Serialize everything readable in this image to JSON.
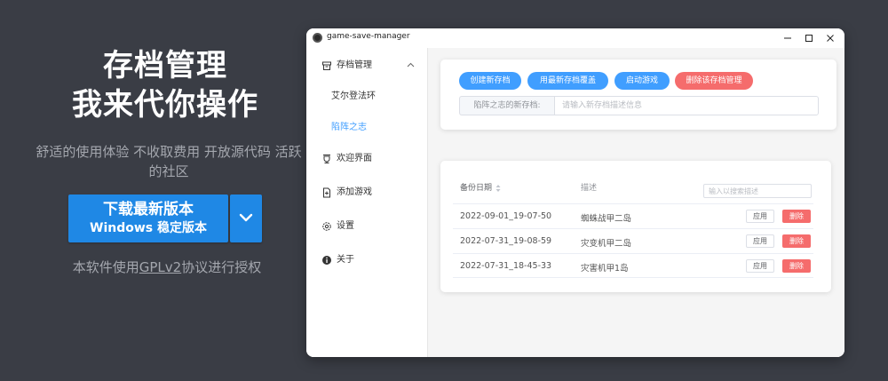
{
  "hero": {
    "title_line1": "存档管理",
    "title_line2": "我来代你操作",
    "subtitle": "舒适的使用体验 不收取费用 开放源代码 活跃的社区",
    "download_button": {
      "label": "下载最新版本",
      "sublabel": "Windows 稳定版本"
    },
    "dropdown_icon": "chevron-down-icon",
    "license": {
      "prefix": "本软件使用",
      "link": "GPLv2",
      "suffix": "协议进行授权"
    }
  },
  "window": {
    "title": "game-save-manager",
    "controls": [
      "minimize-icon",
      "maximize-icon",
      "close-icon"
    ]
  },
  "sidebar": {
    "group": {
      "label": "存档管理",
      "icon": "archive-icon",
      "expanded": true
    },
    "games": [
      {
        "label": "艾尔登法环",
        "active": false
      },
      {
        "label": "陷阵之志",
        "active": true
      }
    ],
    "items": [
      {
        "label": "欢迎界面",
        "icon": "welcome-icon"
      },
      {
        "label": "添加游戏",
        "icon": "add-document-icon"
      },
      {
        "label": "设置",
        "icon": "gear-icon"
      },
      {
        "label": "关于",
        "icon": "info-icon"
      }
    ]
  },
  "actions": {
    "create": "创建新存档",
    "cover": "用最新存档覆盖",
    "start": "启动游戏",
    "delete_game": "删除该存档管理"
  },
  "new_save": {
    "label": "陷阵之志的新存档:",
    "placeholder": "请输入新存档描述信息"
  },
  "table": {
    "col_date": "备份日期",
    "col_desc": "描述",
    "search_placeholder": "输入以搜索描述",
    "apply_label": "应用",
    "delete_label": "删除",
    "rows": [
      {
        "date": "2022-09-01_19-07-50",
        "desc": "蜘蛛战甲二岛"
      },
      {
        "date": "2022-07-31_19-08-59",
        "desc": "灾变机甲二岛"
      },
      {
        "date": "2022-07-31_18-45-33",
        "desc": "灾害机甲1岛"
      }
    ]
  },
  "colors": {
    "page_bg": "#3a3d45",
    "primary": "#409eff",
    "danger": "#f56c6c",
    "download": "#1f88e5"
  }
}
